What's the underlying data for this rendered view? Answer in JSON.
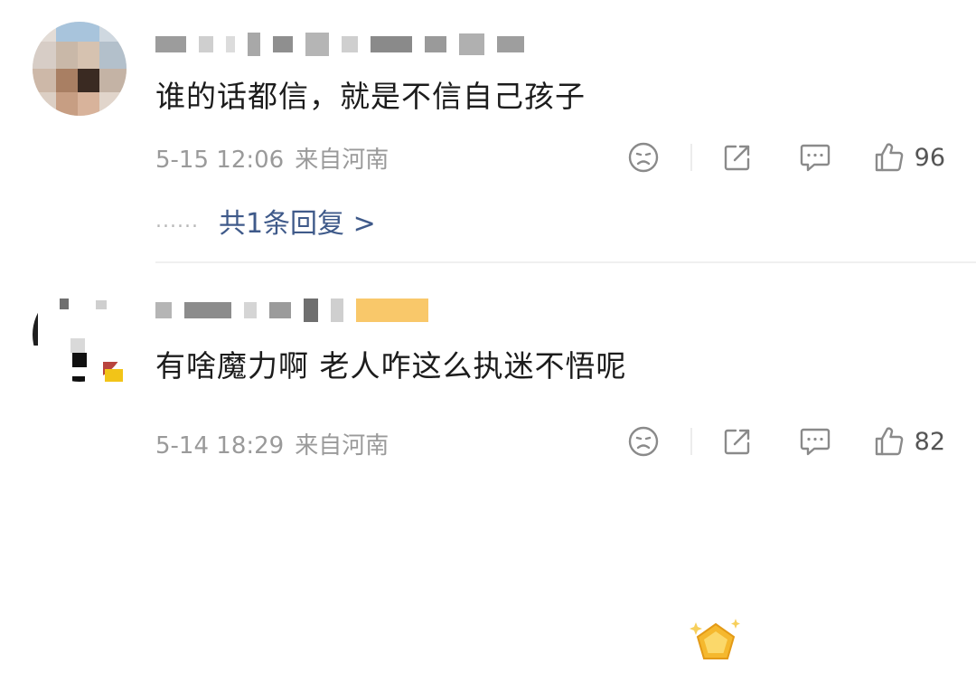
{
  "comments": [
    {
      "text": "谁的话都信，就是不信自己孩子",
      "date": "5-15 12:06",
      "location": "来自河南",
      "likes": "96",
      "replies_label": "共1条回复 >",
      "replies_dots": "......"
    },
    {
      "text": "有啥魔力啊 老人咋这么执迷不悟呢",
      "date": "5-14 18:29",
      "location": "来自河南",
      "likes": "82"
    }
  ],
  "icons": {
    "emoji": "sad-face-icon",
    "share": "share-icon",
    "reply": "comment-bubble-icon",
    "like": "thumbs-up-icon",
    "badge": "gold-pentagon-badge-icon"
  },
  "colors": {
    "text": "#1c1c1c",
    "meta": "#9a9a9a",
    "reply_link": "#3f5a8a",
    "badge_gold": "#f5b82e",
    "icon_grey": "#8a8a8a"
  }
}
